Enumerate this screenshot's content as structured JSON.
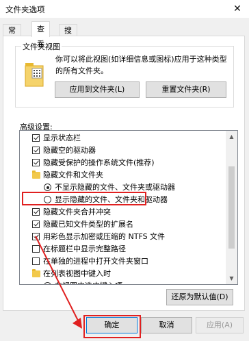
{
  "window": {
    "title": "文件夹选项",
    "close_glyph": "✕"
  },
  "tabs": [
    {
      "label": "常规"
    },
    {
      "label": "查看"
    },
    {
      "label": "搜索"
    }
  ],
  "folder_views": {
    "group_label": "文件夹视图",
    "description": "你可以将此视图(如详细信息或图标)应用于这种类型的所有文件夹。",
    "apply_button": "应用到文件夹(L)",
    "reset_button": "重置文件夹(R)"
  },
  "advanced": {
    "label": "高级设置:",
    "items": [
      {
        "kind": "checkbox",
        "checked": true,
        "indent": 0,
        "label": "显示状态栏"
      },
      {
        "kind": "checkbox",
        "checked": true,
        "indent": 0,
        "label": "隐藏空的驱动器"
      },
      {
        "kind": "checkbox",
        "checked": true,
        "indent": 0,
        "label": "隐藏受保护的操作系统文件(推荐)"
      },
      {
        "kind": "folder",
        "indent": 0,
        "label": "隐藏文件和文件夹"
      },
      {
        "kind": "radio",
        "checked": true,
        "indent": 1,
        "label": "不显示隐藏的文件、文件夹或驱动器"
      },
      {
        "kind": "radio",
        "checked": false,
        "indent": 1,
        "label": "显示隐藏的文件、文件夹和驱动器"
      },
      {
        "kind": "checkbox",
        "checked": true,
        "indent": 0,
        "label": "隐藏文件夹合并冲突"
      },
      {
        "kind": "checkbox",
        "checked": true,
        "indent": 0,
        "label": "隐藏已知文件类型的扩展名"
      },
      {
        "kind": "checkbox",
        "checked": true,
        "indent": 0,
        "label": "用彩色显示加密或压缩的 NTFS 文件"
      },
      {
        "kind": "checkbox",
        "checked": false,
        "indent": 0,
        "label": "在标题栏中显示完整路径"
      },
      {
        "kind": "checkbox",
        "checked": false,
        "indent": 0,
        "label": "在单独的进程中打开文件夹窗口"
      },
      {
        "kind": "folder",
        "indent": 0,
        "label": "在列表视图中键入时"
      },
      {
        "kind": "radio",
        "checked": true,
        "indent": 1,
        "label": "在视图中选中键入项"
      }
    ],
    "restore_button": "还原为默认值(D)"
  },
  "footer": {
    "ok": "确定",
    "cancel": "取消",
    "apply": "应用(A)"
  },
  "colors": {
    "highlight": "#e02020",
    "accent_border": "#0078d7"
  }
}
